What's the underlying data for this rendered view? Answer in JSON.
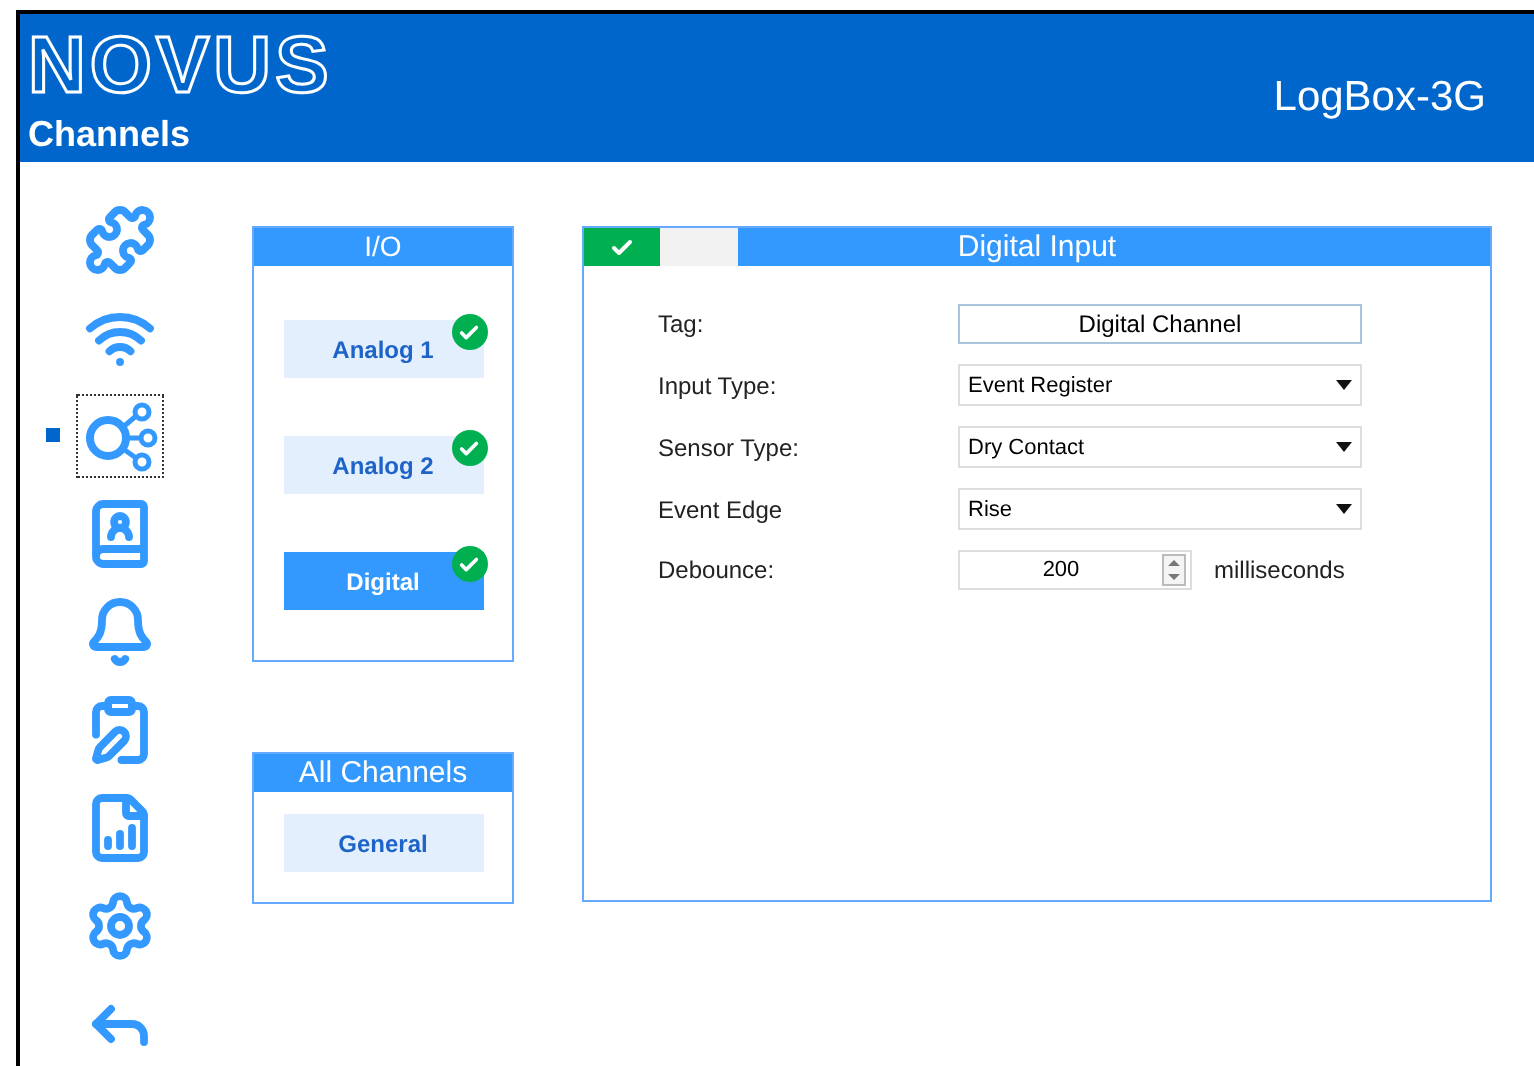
{
  "header": {
    "logo": "NOVUS",
    "page_title": "Channels",
    "device": "LogBox-3G"
  },
  "nav": [
    {
      "selected": false
    },
    {
      "selected": false
    },
    {
      "selected": true
    },
    {
      "selected": false
    },
    {
      "selected": false
    },
    {
      "selected": false
    },
    {
      "selected": false
    },
    {
      "selected": false
    },
    {
      "selected": false
    }
  ],
  "io_panel": {
    "title": "I/O",
    "channels": [
      {
        "label": "Analog 1",
        "selected": false,
        "checked": true
      },
      {
        "label": "Analog 2",
        "selected": false,
        "checked": true
      },
      {
        "label": "Digital",
        "selected": true,
        "checked": true
      }
    ]
  },
  "all_channels_panel": {
    "title": "All Channels",
    "channels": [
      {
        "label": "General",
        "selected": false,
        "checked": false
      }
    ]
  },
  "detail": {
    "title": "Digital Input",
    "enabled": true,
    "fields": [
      {
        "kind": "text",
        "label": "Tag:",
        "value": "Digital Channel"
      },
      {
        "kind": "select",
        "label": "Input Type:",
        "value": "Event Register"
      },
      {
        "kind": "select",
        "label": "Sensor Type:",
        "value": "Dry Contact"
      },
      {
        "kind": "select",
        "label": "Event Edge",
        "value": "Rise"
      },
      {
        "kind": "spin",
        "label": "Debounce:",
        "value": "200",
        "unit": "milliseconds"
      }
    ]
  }
}
